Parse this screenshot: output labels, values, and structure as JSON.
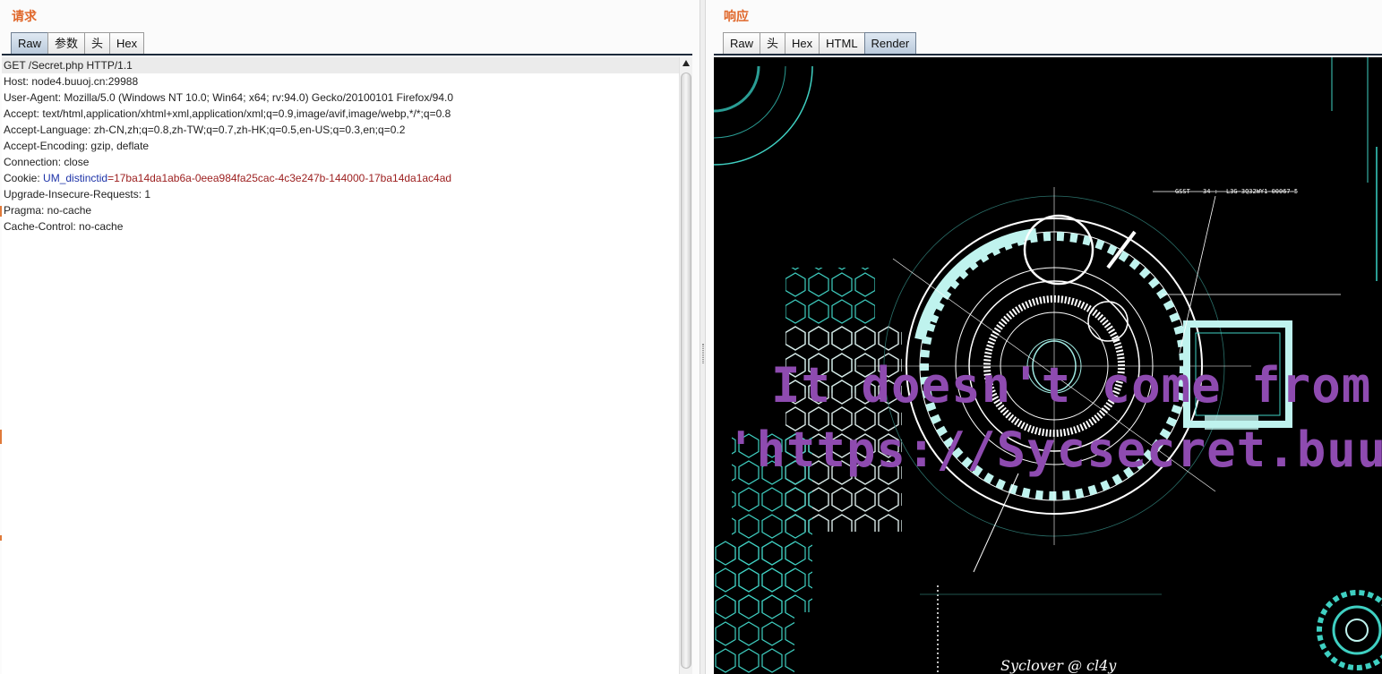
{
  "request": {
    "title": "请求",
    "tabs": [
      {
        "label": "Raw",
        "active": true
      },
      {
        "label": "参数",
        "active": false
      },
      {
        "label": "头",
        "active": false
      },
      {
        "label": "Hex",
        "active": false
      }
    ],
    "lines": [
      "GET /Secret.php HTTP/1.1",
      "Host: node4.buuoj.cn:29988",
      "User-Agent: Mozilla/5.0 (Windows NT 10.0; Win64; x64; rv:94.0) Gecko/20100101 Firefox/94.0",
      "Accept: text/html,application/xhtml+xml,application/xml;q=0.9,image/avif,image/webp,*/*;q=0.8",
      "Accept-Language: zh-CN,zh;q=0.8,zh-TW;q=0.7,zh-HK;q=0.5,en-US;q=0.3,en;q=0.2",
      "Accept-Encoding: gzip, deflate",
      "Connection: close"
    ],
    "cookie": {
      "prefix": "Cookie: ",
      "name": "UM_distinctid",
      "value": "=17ba14da1ab6a-0eea984fa25cac-4c3e247b-144000-17ba14da1ac4ad"
    },
    "lines_after": [
      "Upgrade-Insecure-Requests: 1",
      "Pragma: no-cache",
      "Cache-Control: no-cache"
    ]
  },
  "response": {
    "title": "响应",
    "tabs": [
      {
        "label": "Raw",
        "active": false
      },
      {
        "label": "头",
        "active": false
      },
      {
        "label": "Hex",
        "active": false
      },
      {
        "label": "HTML",
        "active": false
      },
      {
        "label": "Render",
        "active": true
      }
    ],
    "render": {
      "line1": "It doesn't come from",
      "line2": "'https://Sycsecret.buuc",
      "signature": "Syclover @ cl4y",
      "hud_label_1": "GSST",
      "hud_label_2": "34 :",
      "hud_label_3": "L3G-3Q32WY1-00067-5"
    }
  },
  "colors": {
    "title": "#e0672a",
    "tab_active": "#b9c9db",
    "cookie_name": "#1d33a8",
    "cookie_value": "#9b1c1c",
    "render_text": "#8e4bb0",
    "hud_cyan": "#4fe3d6"
  },
  "icons": {
    "scroll_up": "triangle-up-icon"
  }
}
